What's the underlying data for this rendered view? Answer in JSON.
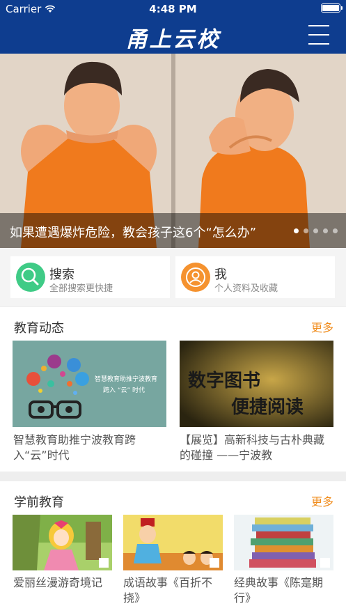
{
  "status_bar": {
    "carrier": "Carrier",
    "time": "4:48 PM"
  },
  "navbar": {
    "title": "甬上云校",
    "menu_icon": "menu-icon"
  },
  "banner": {
    "caption": "如果遭遇爆炸危险，教会孩子这6个“怎么办”",
    "dots_total": 5,
    "active_dot": 1
  },
  "quick_links": [
    {
      "title": "搜索",
      "subtitle": "全部搜索更快捷",
      "icon": "search-icon",
      "color": "#3fcb86"
    },
    {
      "title": "我",
      "subtitle": "个人资料及收藏",
      "icon": "user-icon",
      "color": "#f5922f"
    }
  ],
  "sections": [
    {
      "title": "教育动态",
      "more": "更多",
      "items": [
        {
          "caption": "智慧教育助推宁波教育跨入“云”时代",
          "thumb_text_1": "智慧教育助推宁波教育",
          "thumb_text_2": "跨入 “云” 时代"
        },
        {
          "caption": "【展览】高新科技与古朴典藏的碰撞 ——宁波教",
          "thumb_text_1": "数字图书",
          "thumb_text_2": "便捷阅读"
        }
      ]
    },
    {
      "title": "学前教育",
      "more": "更多",
      "items": [
        {
          "caption": "爱丽丝漫游奇境记"
        },
        {
          "caption": "成语故事《百折不挠》"
        },
        {
          "caption": "经典故事《陈寔期行》"
        }
      ]
    }
  ],
  "colors": {
    "nav": "#0e3d8f",
    "accent": "#f08c1c"
  }
}
